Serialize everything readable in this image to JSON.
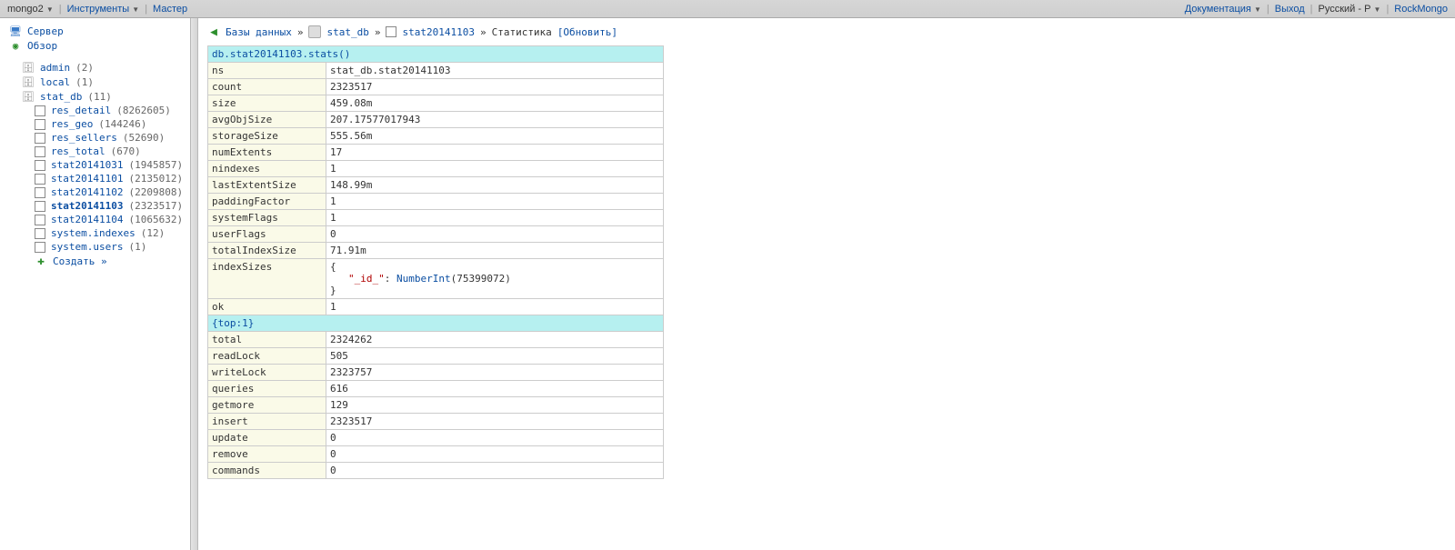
{
  "topbar": {
    "server": "mongo2",
    "tools": "Инструменты",
    "master": "Мастер",
    "docs": "Документация",
    "logout": "Выход",
    "lang": "Русский - Р",
    "brand": "RockMongo"
  },
  "sidebar": {
    "server": "Сервер",
    "overview": "Обзор",
    "databases": [
      {
        "name": "admin",
        "count": "(2)"
      },
      {
        "name": "local",
        "count": "(1)"
      },
      {
        "name": "stat_db",
        "count": "(11)"
      }
    ],
    "collections": [
      {
        "name": "res_detail",
        "count": "(8262605)"
      },
      {
        "name": "res_geo",
        "count": "(144246)"
      },
      {
        "name": "res_sellers",
        "count": "(52690)"
      },
      {
        "name": "res_total",
        "count": "(670)"
      },
      {
        "name": "stat20141031",
        "count": "(1945857)"
      },
      {
        "name": "stat20141101",
        "count": "(2135012)"
      },
      {
        "name": "stat20141102",
        "count": "(2209808)"
      },
      {
        "name": "stat20141103",
        "count": "(2323517)",
        "selected": true
      },
      {
        "name": "stat20141104",
        "count": "(1065632)"
      },
      {
        "name": "system.indexes",
        "count": "(12)"
      },
      {
        "name": "system.users",
        "count": "(1)"
      }
    ],
    "create": "Создать »"
  },
  "breadcrumb": {
    "databases": "Базы данных",
    "db": "stat_db",
    "coll": "stat20141103",
    "stats": "Статистика",
    "refresh": "[Обновить]"
  },
  "stats": {
    "header1": "db.stat20141103.stats()",
    "rows1": [
      {
        "k": "ns",
        "v": "stat_db.stat20141103"
      },
      {
        "k": "count",
        "v": "2323517"
      },
      {
        "k": "size",
        "v": "459.08m"
      },
      {
        "k": "avgObjSize",
        "v": "207.17577017943"
      },
      {
        "k": "storageSize",
        "v": "555.56m"
      },
      {
        "k": "numExtents",
        "v": "17"
      },
      {
        "k": "nindexes",
        "v": "1"
      },
      {
        "k": "lastExtentSize",
        "v": "148.99m"
      },
      {
        "k": "paddingFactor",
        "v": "1"
      },
      {
        "k": "systemFlags",
        "v": "1"
      },
      {
        "k": "userFlags",
        "v": "0"
      },
      {
        "k": "totalIndexSize",
        "v": "71.91m"
      }
    ],
    "indexSizesKey": "indexSizes",
    "indexSizesField": "\"_id_\"",
    "indexSizesFunc": "NumberInt",
    "indexSizesArg": "(75399072)",
    "okKey": "ok",
    "okVal": "1",
    "header2": "{top:1}",
    "rows2": [
      {
        "k": "total",
        "v": "2324262"
      },
      {
        "k": "readLock",
        "v": "505"
      },
      {
        "k": "writeLock",
        "v": "2323757"
      },
      {
        "k": "queries",
        "v": "616"
      },
      {
        "k": "getmore",
        "v": "129"
      },
      {
        "k": "insert",
        "v": "2323517"
      },
      {
        "k": "update",
        "v": "0"
      },
      {
        "k": "remove",
        "v": "0"
      },
      {
        "k": "commands",
        "v": "0"
      }
    ]
  }
}
